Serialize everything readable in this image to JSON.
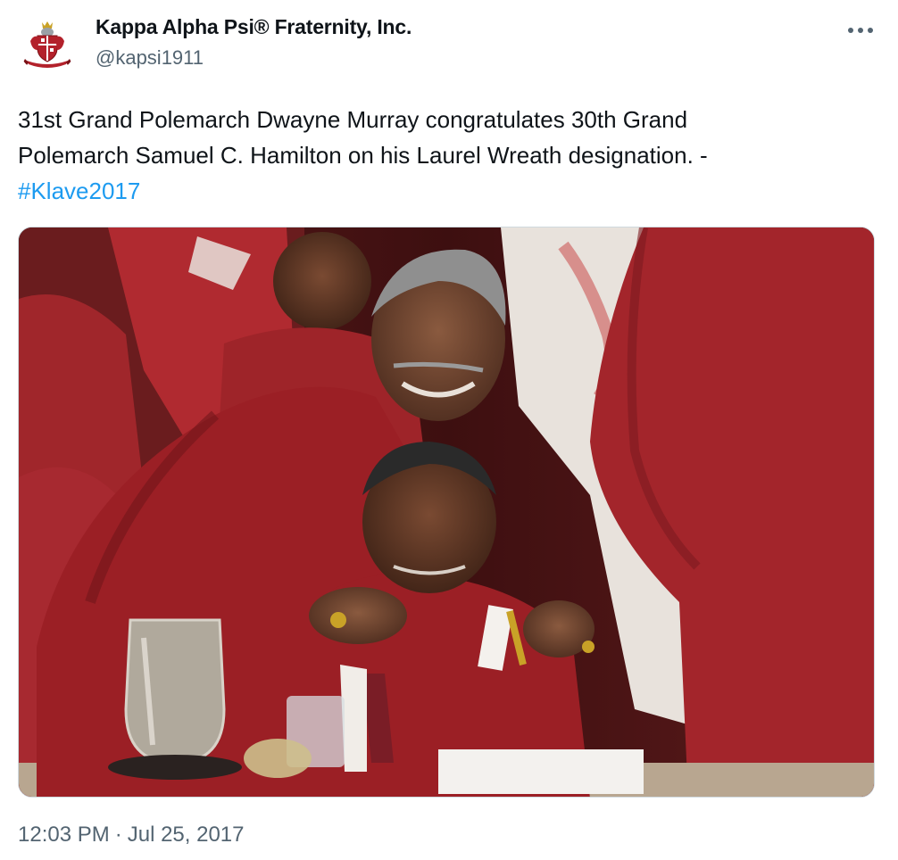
{
  "author": {
    "display_name": "Kappa Alpha Psi® Fraternity, Inc.",
    "handle": "@kapsi1911",
    "avatar_icon": "crest-icon"
  },
  "menu": {
    "icon": "more-horizontal-icon"
  },
  "tweet": {
    "line1": "31st Grand Polemarch Dwayne Murray congratulates 30th Grand",
    "line2": "Polemarch Samuel C. Hamilton on his Laurel Wreath designation. -",
    "hashtag": "#Klave2017"
  },
  "media": {
    "alt": "photo"
  },
  "meta": {
    "time": "12:03 PM",
    "separator": "·",
    "date": "Jul 25, 2017"
  },
  "colors": {
    "text": "#0f1419",
    "secondary": "#536471",
    "link": "#1d9bf0",
    "jacket_red": "#a3252b"
  }
}
